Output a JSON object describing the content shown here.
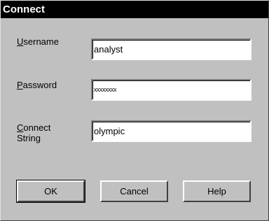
{
  "window": {
    "title": "Connect"
  },
  "form": {
    "username": {
      "label_accel": "U",
      "label_rest": "sername",
      "value": "analyst"
    },
    "password": {
      "label_accel": "P",
      "label_rest": "assword",
      "value": "xxxxxxxx"
    },
    "connect_string": {
      "label_accel": "C",
      "label_rest": "onnect",
      "label_line2": "String",
      "value": "olympic"
    }
  },
  "buttons": {
    "ok": "OK",
    "cancel": "Cancel",
    "help": "Help"
  },
  "colors": {
    "face": "#c0c0c0",
    "titlebar": "#000000",
    "title_text": "#ffffff"
  }
}
